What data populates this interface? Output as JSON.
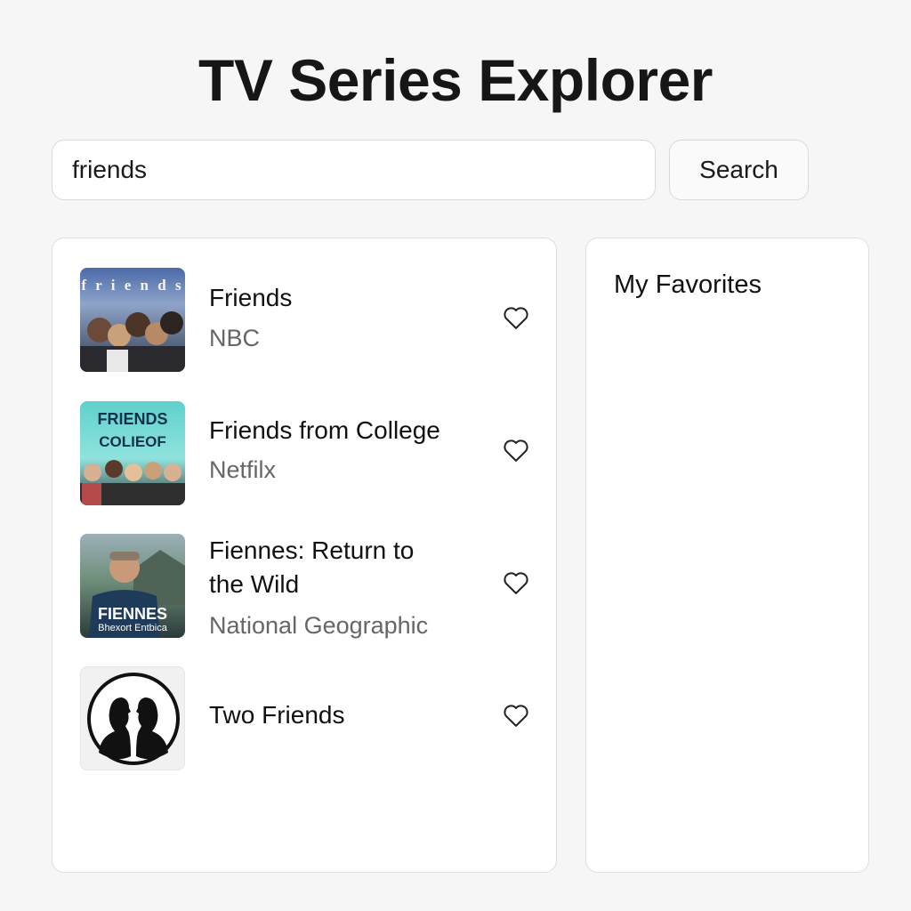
{
  "app": {
    "title": "TV Series Explorer"
  },
  "search": {
    "value": "friends",
    "button_label": "Search"
  },
  "results": [
    {
      "title": "Friends",
      "network": "NBC",
      "thumb_text": "f r i e n d s"
    },
    {
      "title": "Friends from College",
      "network": "Netfilx",
      "thumb_text_1": "FRIENDS",
      "thumb_text_2": "COLIEOF"
    },
    {
      "title_line1": "Fiennes: Return to",
      "title_line2": "the Wild",
      "network": "National Geographic",
      "thumb_text_1": "FIENNES",
      "thumb_text_2": "Bhexort Entbica"
    },
    {
      "title": "Two Friends",
      "network": ""
    }
  ],
  "favorites": {
    "title": "My Favorites",
    "items": []
  },
  "icons": {
    "favorite": "heart-outline-icon"
  },
  "colors": {
    "background": "#f6f6f6",
    "panel": "#ffffff",
    "border": "#dedede",
    "muted_text": "#666666"
  }
}
